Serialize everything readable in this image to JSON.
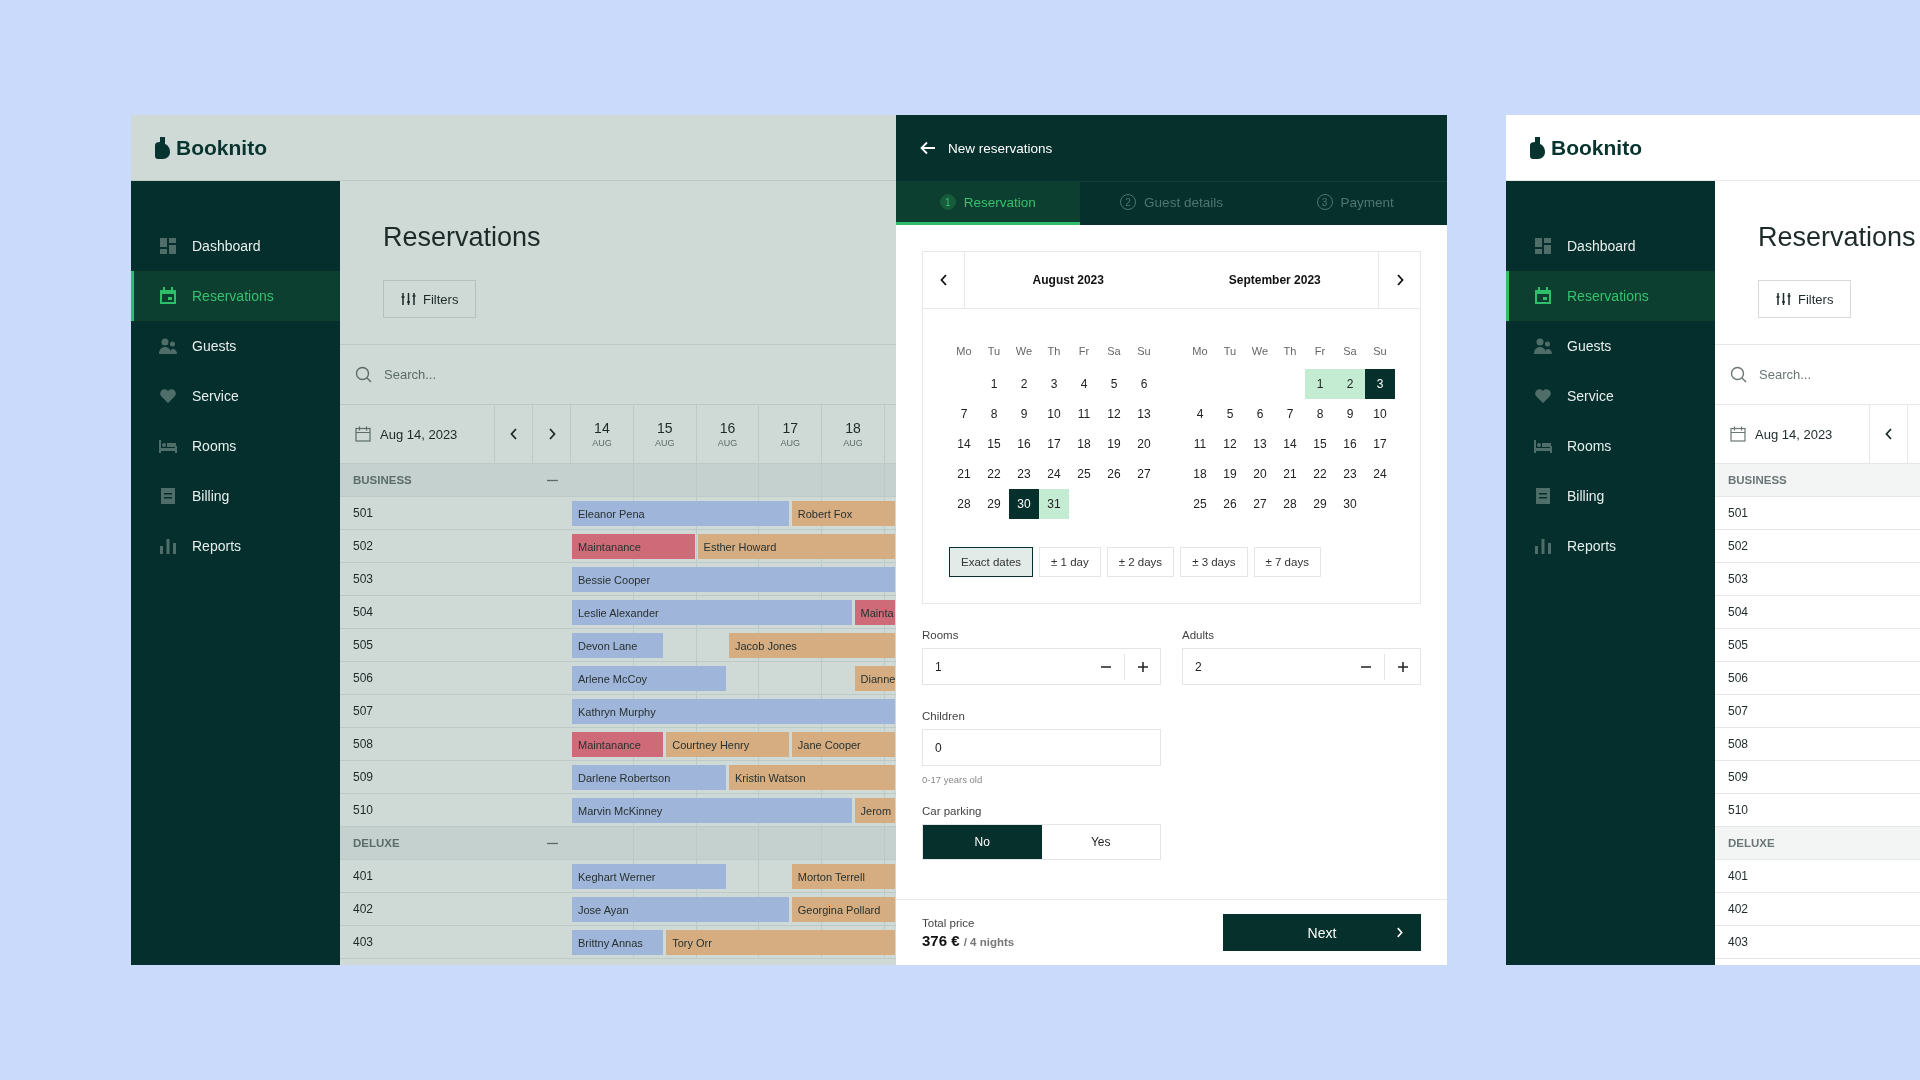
{
  "background_app": {
    "dimmed": true,
    "logo": "Booknito",
    "nav": [
      {
        "label": "Dashboard",
        "selected": false
      },
      {
        "label": "Reservations",
        "selected": true
      },
      {
        "label": "Guests",
        "selected": false
      },
      {
        "label": "Service",
        "selected": false
      },
      {
        "label": "Rooms",
        "selected": false
      },
      {
        "label": "Billing",
        "selected": false
      },
      {
        "label": "Reports",
        "selected": false
      }
    ],
    "title": "Reservations",
    "filters_button": "Filters",
    "search": {
      "placeholder": "Search..."
    },
    "date": "Aug 14, 2023",
    "days": [
      {
        "day": "14",
        "month": "AUG"
      },
      {
        "day": "15",
        "month": "AUG"
      },
      {
        "day": "16",
        "month": "AUG"
      },
      {
        "day": "17",
        "month": "AUG"
      },
      {
        "day": "18",
        "month": "AUG"
      }
    ],
    "groups": [
      {
        "name": "BUSINESS",
        "collapsed": false,
        "rooms": [
          {
            "number": "501",
            "bookings": [
              {
                "guest": "Eleanor Pena",
                "color": "#9fb5d9"
              },
              {
                "guest": "Robert Fox",
                "color": "#d6ad80"
              }
            ]
          },
          {
            "number": "502",
            "bookings": [
              {
                "guest": "Maintanance",
                "color": "#cf6b79"
              },
              {
                "guest": "Esther Howard",
                "color": "#d6ad80"
              }
            ]
          },
          {
            "number": "503",
            "bookings": [
              {
                "guest": "Bessie Cooper",
                "color": "#9fb5d9"
              }
            ]
          },
          {
            "number": "504",
            "bookings": [
              {
                "guest": "Leslie Alexander",
                "color": "#9fb5d9"
              },
              {
                "guest": "Mainta",
                "color": "#cf6b79"
              }
            ]
          },
          {
            "number": "505",
            "bookings": [
              {
                "guest": "Devon Lane",
                "color": "#9fb5d9"
              },
              {
                "guest": "Jacob Jones",
                "color": "#d6ad80"
              }
            ]
          },
          {
            "number": "506",
            "bookings": [
              {
                "guest": "Arlene McCoy",
                "color": "#9fb5d9"
              },
              {
                "guest": "Dianne",
                "color": "#d6ad80"
              }
            ]
          },
          {
            "number": "507",
            "bookings": [
              {
                "guest": "Kathryn Murphy",
                "color": "#9fb5d9"
              }
            ]
          },
          {
            "number": "508",
            "bookings": [
              {
                "guest": "Maintanance",
                "color": "#cf6b79"
              },
              {
                "guest": "Courtney Henry",
                "color": "#d6ad80"
              },
              {
                "guest": "Jane Cooper",
                "color": "#d6ad80"
              }
            ]
          },
          {
            "number": "509",
            "bookings": [
              {
                "guest": "Darlene Robertson",
                "color": "#9fb5d9"
              },
              {
                "guest": "Kristin Watson",
                "color": "#d6ad80"
              }
            ]
          },
          {
            "number": "510",
            "bookings": [
              {
                "guest": "Marvin McKinney",
                "color": "#9fb5d9"
              },
              {
                "guest": "Jerom",
                "color": "#d6ad80"
              }
            ]
          }
        ]
      },
      {
        "name": "DELUXE",
        "collapsed": false,
        "rooms": [
          {
            "number": "401",
            "bookings": [
              {
                "guest": "Keghart Werner",
                "color": "#9fb5d9"
              },
              {
                "guest": "Morton Terrell",
                "color": "#d6ad80"
              }
            ]
          },
          {
            "number": "402",
            "bookings": [
              {
                "guest": "Jose Ayan",
                "color": "#9fb5d9"
              },
              {
                "guest": "Georgina Pollard",
                "color": "#d6ad80"
              }
            ]
          },
          {
            "number": "403",
            "bookings": [
              {
                "guest": "Brittny Annas",
                "color": "#9fb5d9"
              },
              {
                "guest": "Tory Orr",
                "color": "#d6ad80"
              }
            ]
          }
        ]
      }
    ]
  },
  "reservation_panel": {
    "title": "New reservations",
    "tabs": [
      {
        "number": "1",
        "label": "Reservation",
        "selected": true
      },
      {
        "number": "2",
        "label": "Guest details",
        "selected": false
      },
      {
        "number": "3",
        "label": "Payment",
        "selected": false
      }
    ],
    "calendar": {
      "months": [
        {
          "name": "August 2023",
          "weekdays": [
            "Mo",
            "Tu",
            "We",
            "Th",
            "Fr",
            "Sa",
            "Su"
          ],
          "weeks": [
            [
              {
                "day": "1",
                "selected": false,
                "in_range": false
              },
              {
                "day": "2",
                "selected": false,
                "in_range": false
              },
              {
                "day": "3",
                "selected": false,
                "in_range": false
              },
              {
                "day": "4",
                "selected": false,
                "in_range": false
              },
              {
                "day": "5",
                "selected": false,
                "in_range": false
              },
              {
                "day": "6",
                "selected": false,
                "in_range": false
              }
            ],
            [
              {
                "day": "7",
                "selected": false,
                "in_range": false
              },
              {
                "day": "8",
                "selected": false,
                "in_range": false
              },
              {
                "day": "9",
                "selected": false,
                "in_range": false
              },
              {
                "day": "10",
                "selected": false,
                "in_range": false
              },
              {
                "day": "11",
                "selected": false,
                "in_range": false
              },
              {
                "day": "12",
                "selected": false,
                "in_range": false
              },
              {
                "day": "13",
                "selected": false,
                "in_range": false
              }
            ],
            [
              {
                "day": "14",
                "selected": false,
                "in_range": false
              },
              {
                "day": "15",
                "selected": false,
                "in_range": false
              },
              {
                "day": "16",
                "selected": false,
                "in_range": false
              },
              {
                "day": "17",
                "selected": false,
                "in_range": false
              },
              {
                "day": "18",
                "selected": false,
                "in_range": false
              },
              {
                "day": "19",
                "selected": false,
                "in_range": false
              },
              {
                "day": "20",
                "selected": false,
                "in_range": false
              }
            ],
            [
              {
                "day": "21",
                "selected": false,
                "in_range": false
              },
              {
                "day": "22",
                "selected": false,
                "in_range": false
              },
              {
                "day": "23",
                "selected": false,
                "in_range": false
              },
              {
                "day": "24",
                "selected": false,
                "in_range": false
              },
              {
                "day": "25",
                "selected": false,
                "in_range": false
              },
              {
                "day": "26",
                "selected": false,
                "in_range": false
              },
              {
                "day": "27",
                "selected": false,
                "in_range": false
              }
            ],
            [
              {
                "day": "28",
                "selected": false,
                "in_range": false
              },
              {
                "day": "29",
                "selected": false,
                "in_range": false
              },
              {
                "day": "30",
                "selected": true,
                "in_range": false
              },
              {
                "day": "31",
                "selected": false,
                "in_range": true
              }
            ]
          ]
        },
        {
          "name": "September 2023",
          "weekdays": [
            "Mo",
            "Tu",
            "We",
            "Th",
            "Fr",
            "Sa",
            "Su"
          ],
          "weeks": [
            [
              {
                "day": "1",
                "selected": false,
                "in_range": true
              },
              {
                "day": "2",
                "selected": false,
                "in_range": true
              },
              {
                "day": "3",
                "selected": true,
                "in_range": false
              }
            ],
            [
              {
                "day": "4",
                "selected": false,
                "in_range": false
              },
              {
                "day": "5",
                "selected": false,
                "in_range": false
              },
              {
                "day": "6",
                "selected": false,
                "in_range": false
              },
              {
                "day": "7",
                "selected": false,
                "in_range": false
              },
              {
                "day": "8",
                "selected": false,
                "in_range": false
              },
              {
                "day": "9",
                "selected": false,
                "in_range": false
              },
              {
                "day": "10",
                "selected": false,
                "in_range": false
              }
            ],
            [
              {
                "day": "11",
                "selected": false,
                "in_range": false
              },
              {
                "day": "12",
                "selected": false,
                "in_range": false
              },
              {
                "day": "13",
                "selected": false,
                "in_range": false
              },
              {
                "day": "14",
                "selected": false,
                "in_range": false
              },
              {
                "day": "15",
                "selected": false,
                "in_range": false
              },
              {
                "day": "16",
                "selected": false,
                "in_range": false
              },
              {
                "day": "17",
                "selected": false,
                "in_range": false
              }
            ],
            [
              {
                "day": "18",
                "selected": false,
                "in_range": false
              },
              {
                "day": "19",
                "selected": false,
                "in_range": false
              },
              {
                "day": "20",
                "selected": false,
                "in_range": false
              },
              {
                "day": "21",
                "selected": false,
                "in_range": false
              },
              {
                "day": "22",
                "selected": false,
                "in_range": false
              },
              {
                "day": "23",
                "selected": false,
                "in_range": false
              },
              {
                "day": "24",
                "selected": false,
                "in_range": false
              }
            ],
            [
              {
                "day": "25",
                "selected": false,
                "in_range": false
              },
              {
                "day": "26",
                "selected": false,
                "in_range": false
              },
              {
                "day": "27",
                "selected": false,
                "in_range": false
              },
              {
                "day": "28",
                "selected": false,
                "in_range": false
              },
              {
                "day": "29",
                "selected": false,
                "in_range": false
              },
              {
                "day": "30",
                "selected": false,
                "in_range": false
              }
            ]
          ]
        }
      ],
      "flex_options": [
        {
          "label": "Exact dates",
          "selected": true
        },
        {
          "label": "± 1 day",
          "selected": false
        },
        {
          "label": "± 2 days",
          "selected": false
        },
        {
          "label": "± 3 days",
          "selected": false
        },
        {
          "label": "± 7 days",
          "selected": false
        }
      ]
    },
    "rooms": {
      "label": "Rooms",
      "value": "1"
    },
    "adults": {
      "label": "Adults",
      "value": "2"
    },
    "children": {
      "label": "Children",
      "value": "0",
      "hint": "0-17 years old"
    },
    "car_parking": {
      "label": "Car parking",
      "options": [
        {
          "label": "No",
          "selected": true
        },
        {
          "label": "Yes",
          "selected": false
        }
      ]
    },
    "total": {
      "label": "Total price",
      "price": "376 €",
      "nights": "/ 4 nights"
    },
    "next_button": "Next"
  },
  "preview_app": {
    "dimmed": false,
    "logo": "Booknito",
    "nav": [
      {
        "label": "Dashboard",
        "selected": false
      },
      {
        "label": "Reservations",
        "selected": true
      },
      {
        "label": "Guests",
        "selected": false
      },
      {
        "label": "Service",
        "selected": false
      },
      {
        "label": "Rooms",
        "selected": false
      },
      {
        "label": "Billing",
        "selected": false
      },
      {
        "label": "Reports",
        "selected": false
      }
    ],
    "title": "Reservations",
    "filters_button": "Filters",
    "search": {
      "placeholder": "Search..."
    },
    "date": "Aug 14, 2023",
    "groups": [
      {
        "name": "BUSINESS",
        "rooms": [
          {
            "number": "501"
          },
          {
            "number": "502"
          },
          {
            "number": "503"
          },
          {
            "number": "504"
          },
          {
            "number": "505"
          },
          {
            "number": "506"
          },
          {
            "number": "507"
          },
          {
            "number": "508"
          },
          {
            "number": "509"
          },
          {
            "number": "510"
          }
        ]
      },
      {
        "name": "DELUXE",
        "rooms": [
          {
            "number": "401"
          },
          {
            "number": "402"
          },
          {
            "number": "403"
          }
        ]
      }
    ]
  }
}
